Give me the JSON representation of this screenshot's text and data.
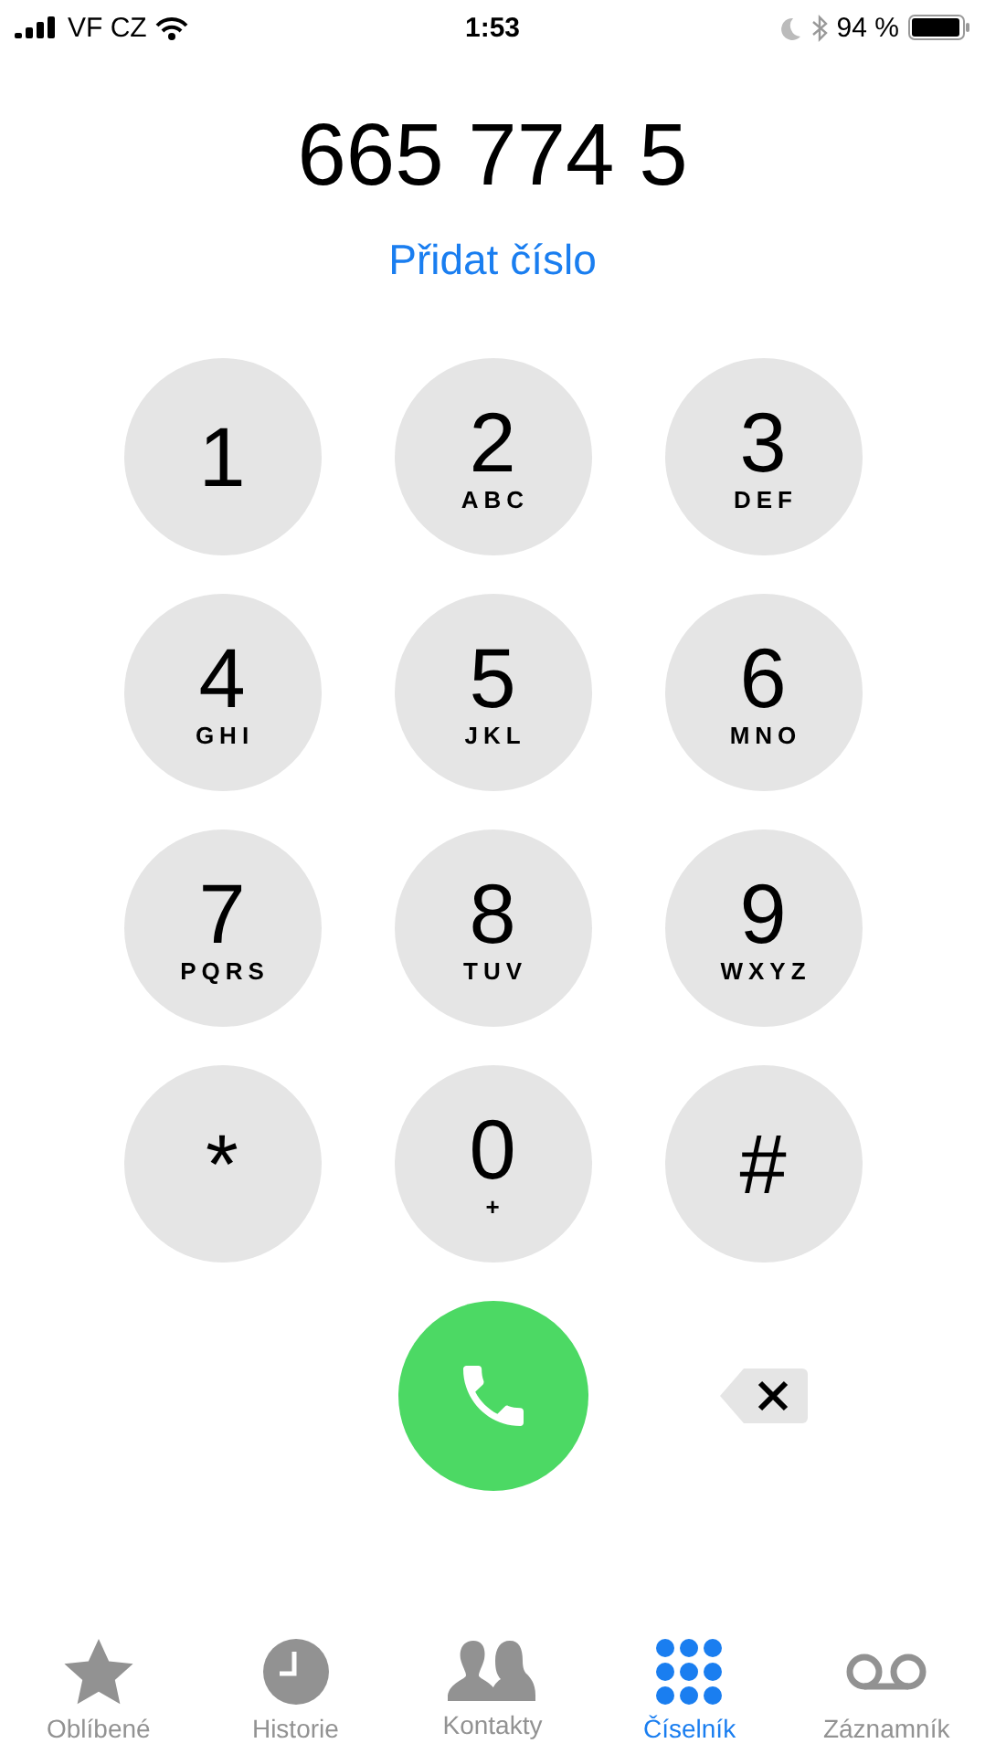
{
  "status_bar": {
    "carrier": "VF CZ",
    "time": "1:53",
    "battery": "94 %"
  },
  "dialed_number": "665 774 5",
  "add_number_link": "Přidat číslo",
  "keys": [
    {
      "digit": "1"
    },
    {
      "digit": "2",
      "letters": "ABC"
    },
    {
      "digit": "3",
      "letters": "DEF"
    },
    {
      "digit": "4",
      "letters": "GHI"
    },
    {
      "digit": "5",
      "letters": "JKL"
    },
    {
      "digit": "6",
      "letters": "MNO"
    },
    {
      "digit": "7",
      "letters": "PQRS"
    },
    {
      "digit": "8",
      "letters": "TUV"
    },
    {
      "digit": "9",
      "letters": "WXYZ"
    },
    {
      "digit": "*"
    },
    {
      "digit": "0",
      "letters": "+"
    },
    {
      "digit": "#"
    }
  ],
  "tabs": [
    {
      "kind": "star",
      "label": "Oblíbené",
      "selected": false
    },
    {
      "kind": "clock",
      "label": "Historie",
      "selected": false
    },
    {
      "kind": "people",
      "label": "Kontakty",
      "selected": false
    },
    {
      "kind": "keypad",
      "label": "Číselník",
      "selected": true
    },
    {
      "kind": "voicemail",
      "label": "Záznamník",
      "selected": false
    }
  ]
}
